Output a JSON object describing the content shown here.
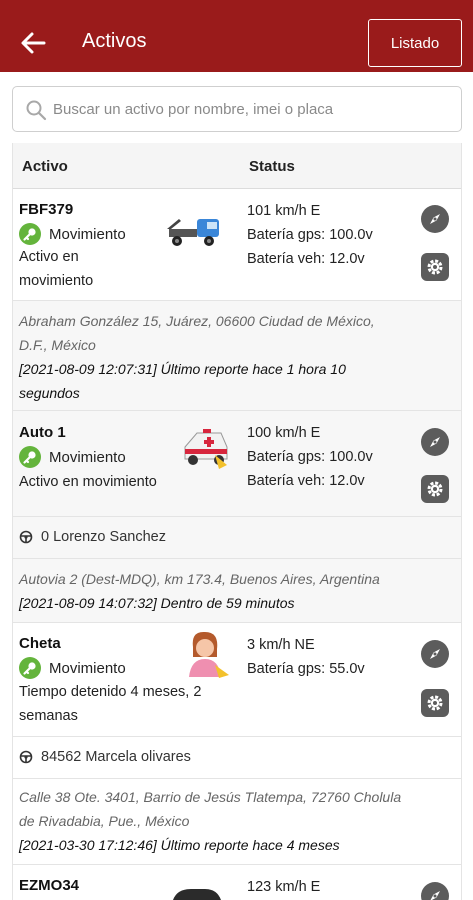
{
  "header": {
    "title": "Activos",
    "listado_label": "Listado",
    "color": "#9a1b1b"
  },
  "search": {
    "placeholder": "Buscar un activo por nombre, imei o placa",
    "value": ""
  },
  "table": {
    "col_activo": "Activo",
    "col_status": "Status"
  },
  "assets": [
    {
      "name": "FBF379",
      "state": "Movimiento",
      "desc_1": "Activo en",
      "desc_2": "movimiento",
      "icon": "tow-truck-icon",
      "speed": "101 km/h E",
      "bat_gps": "Batería gps: 100.0v",
      "bat_veh": "Batería veh: 12.0v",
      "address_1": "Abraham González 15, Juárez, 06600 Ciudad de México,",
      "address_2": "D.F., México",
      "report_1": "[2021-08-09 12:07:31] Último reporte hace 1 hora 10",
      "report_2": "segundos"
    },
    {
      "name": "Auto 1",
      "state": "Movimiento",
      "desc_1": "Activo en movimiento",
      "icon": "ambulance-icon",
      "speed": "100 km/h E",
      "bat_gps": "Batería gps: 100.0v",
      "bat_veh": "Batería veh: 12.0v",
      "driver": "0 Lorenzo Sanchez",
      "address_1": "Autovia 2 (Dest-MDQ), km 173.4, Buenos Aires, Argentina",
      "report_1": "[2021-08-09 14:07:32] Dentro de 59 minutos"
    },
    {
      "name": "Cheta",
      "state": "Movimiento",
      "desc_1": "Tiempo detenido 4 meses, 2",
      "desc_2": "semanas",
      "icon": "person-icon",
      "speed": "3 km/h NE",
      "bat_gps": "Batería gps: 55.0v",
      "driver": "84562 Marcela olivares",
      "address_1": "Calle 38 Ote. 3401, Barrio de Jesús Tlatempa, 72760 Cholula",
      "address_2": "de Rivadabia, Pue., México",
      "report_1": "[2021-03-30 17:12:46] Último reporte hace 4 meses"
    },
    {
      "name": "EZMO34",
      "icon": "car-icon",
      "speed": "123 km/h E"
    }
  ]
}
